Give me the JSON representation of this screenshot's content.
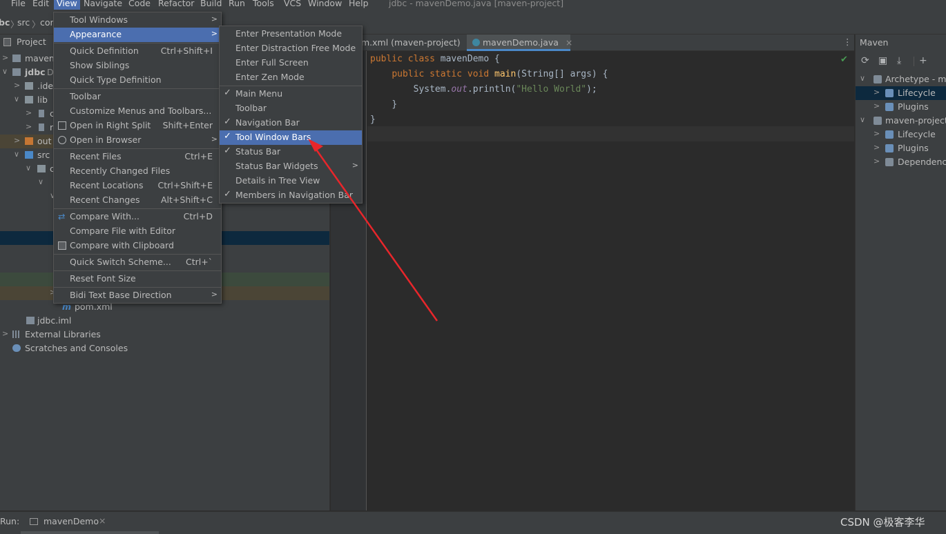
{
  "menubar": {
    "items": [
      "File",
      "Edit",
      "View",
      "Navigate",
      "Code",
      "Refactor",
      "Build",
      "Run",
      "Tools",
      "VCS",
      "Window",
      "Help"
    ],
    "window_title": "jdbc - mavenDemo.java [maven-project]"
  },
  "breadcrumb": {
    "items": [
      "bc",
      "src",
      "cor"
    ]
  },
  "project_panel": {
    "title": "Project",
    "rows": [
      "maven-",
      "jdbc",
      "D",
      ".ide",
      "lib",
      "c",
      "r",
      "out",
      "src",
      "c",
      "pom.xml",
      "jdbc.iml",
      "External Libraries",
      "Scratches and Consoles"
    ]
  },
  "editor": {
    "tabs": [
      "m.xml (maven-project)",
      "mavenDemo.java"
    ],
    "code": {
      "l1_kw": "public class ",
      "l1_name": "mavenDemo {",
      "l2_kw": "public static void ",
      "l2_fn": "main",
      "l2_rest": "(String[] args) {",
      "l3_a": "System.",
      "l3_out": "out",
      "l3_b": ".println(",
      "l3_str": "\"Hello World\"",
      "l3_c": ");",
      "l4": "}",
      "l5": "}"
    }
  },
  "maven_panel": {
    "title": "Maven",
    "rows": [
      "Archetype - ma",
      "Lifecycle",
      "Plugins",
      "maven-project",
      "Lifecycle",
      "Plugins",
      "Dependencie"
    ]
  },
  "view_menu": {
    "items": [
      {
        "label": "Tool Windows",
        "shortcut": ""
      },
      {
        "label": "Appearance",
        "shortcut": ""
      },
      {
        "label": "Quick Definition",
        "shortcut": "Ctrl+Shift+I"
      },
      {
        "label": "Show Siblings",
        "shortcut": ""
      },
      {
        "label": "Quick Type Definition",
        "shortcut": ""
      },
      {
        "label": "Toolbar",
        "shortcut": ""
      },
      {
        "label": "Customize Menus and Toolbars...",
        "shortcut": ""
      },
      {
        "label": "Open in Right Split",
        "shortcut": "Shift+Enter"
      },
      {
        "label": "Open in Browser",
        "shortcut": ""
      },
      {
        "label": "Recent Files",
        "shortcut": "Ctrl+E"
      },
      {
        "label": "Recently Changed Files",
        "shortcut": ""
      },
      {
        "label": "Recent Locations",
        "shortcut": "Ctrl+Shift+E"
      },
      {
        "label": "Recent Changes",
        "shortcut": "Alt+Shift+C"
      },
      {
        "label": "Compare With...",
        "shortcut": "Ctrl+D"
      },
      {
        "label": "Compare File with Editor",
        "shortcut": ""
      },
      {
        "label": "Compare with Clipboard",
        "shortcut": ""
      },
      {
        "label": "Quick Switch Scheme...",
        "shortcut": "Ctrl+`"
      },
      {
        "label": "Reset Font Size",
        "shortcut": ""
      },
      {
        "label": "Bidi Text Base Direction",
        "shortcut": ""
      }
    ]
  },
  "appearance_menu": {
    "items": [
      "Enter Presentation Mode",
      "Enter Distraction Free Mode",
      "Enter Full Screen",
      "Enter Zen Mode",
      "Main Menu",
      "Toolbar",
      "Navigation Bar",
      "Tool Window Bars",
      "Status Bar",
      "Status Bar Widgets",
      "Details in Tree View",
      "Members in Navigation Bar"
    ]
  },
  "bottom": {
    "run_label": "Run:",
    "run_tab": "mavenDemo"
  },
  "watermark": "CSDN @极客李华",
  "colors": {
    "highlight": "#4b6eaf",
    "panel": "#3c3f41",
    "editor": "#2b2b2b",
    "arrow": "#e8262b"
  }
}
